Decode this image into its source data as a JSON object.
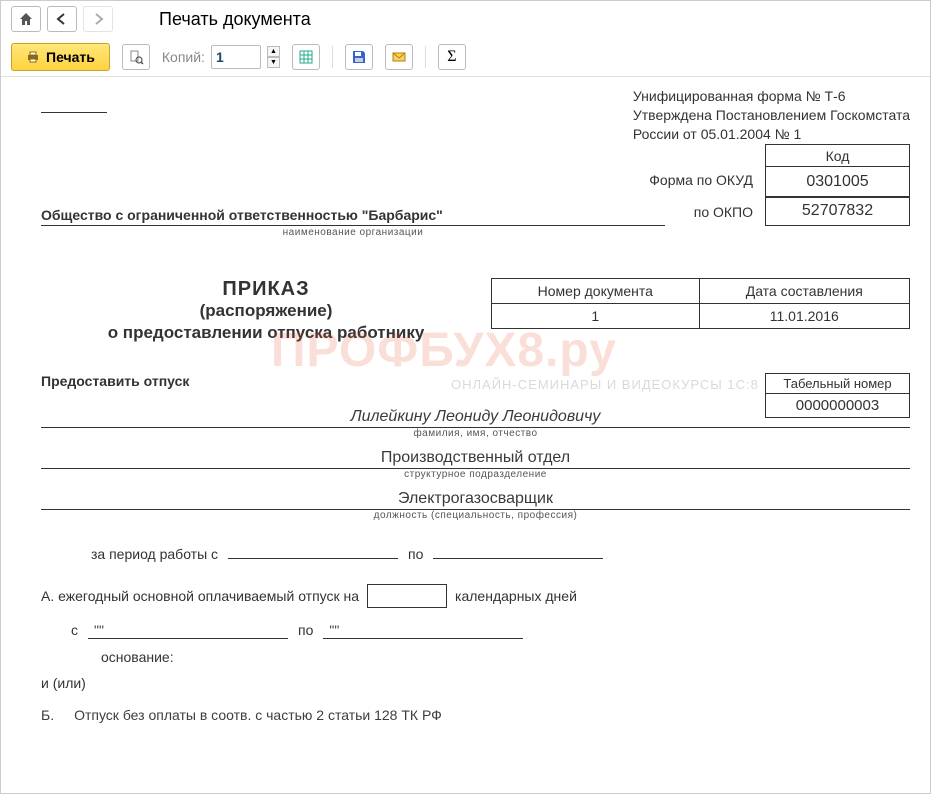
{
  "nav": {
    "title": "Печать документа"
  },
  "toolbar": {
    "print_label": "Печать",
    "copies_label": "Копий:",
    "copies_value": "1"
  },
  "doc": {
    "form_line1": "Унифицированная форма № Т-6",
    "form_line2": "Утверждена Постановлением Госкомстата",
    "form_line3": "России от 05.01.2004 № 1",
    "code_header": "Код",
    "okud_label": "Форма по ОКУД",
    "okud_value": "0301005",
    "okpo_label": "по ОКПО",
    "okpo_value": "52707832",
    "org_name": "Общество с ограниченной ответственностью \"Барбарис\"",
    "org_caption": "наименование организации",
    "num_header": "Номер документа",
    "date_header": "Дата составления",
    "doc_number": "1",
    "doc_date": "11.01.2016",
    "prikaz1": "ПРИКАЗ",
    "prikaz2": "(распоряжение)",
    "prikaz3": "о предоставлении отпуска работнику",
    "grant_label": "Предоставить отпуск",
    "tabnum_header": "Табельный номер",
    "tabnum_value": "0000000003",
    "fio_value": "Лилейкину Леониду Леонидовичу",
    "fio_caption": "фамилия, имя, отчество",
    "dept_value": "Производственный отдел",
    "dept_caption": "структурное подразделение",
    "pos_value": "Электрогазосварщик",
    "pos_caption": "должность (специальность, профессия)",
    "period_label": "за период работы с",
    "period_to": "по",
    "a_label": "А. ежегодный основной оплачиваемый отпуск на",
    "a_days": "календарных дней",
    "date_from_label": "с",
    "date_from_q": "\"\"",
    "date_to_label": "по",
    "date_to_q": "\"\"",
    "basis_label": "основание:",
    "ili_label": "и (или)",
    "b_label": "Б.",
    "b_text": "Отпуск без оплаты в соотв. с частью 2 статьи 128 ТК РФ",
    "watermark": "ПРОФБУХ8.ру",
    "watermark_sub": "ОНЛАЙН-СЕМИНАРЫ И ВИДЕОКУРСЫ 1С:8"
  }
}
